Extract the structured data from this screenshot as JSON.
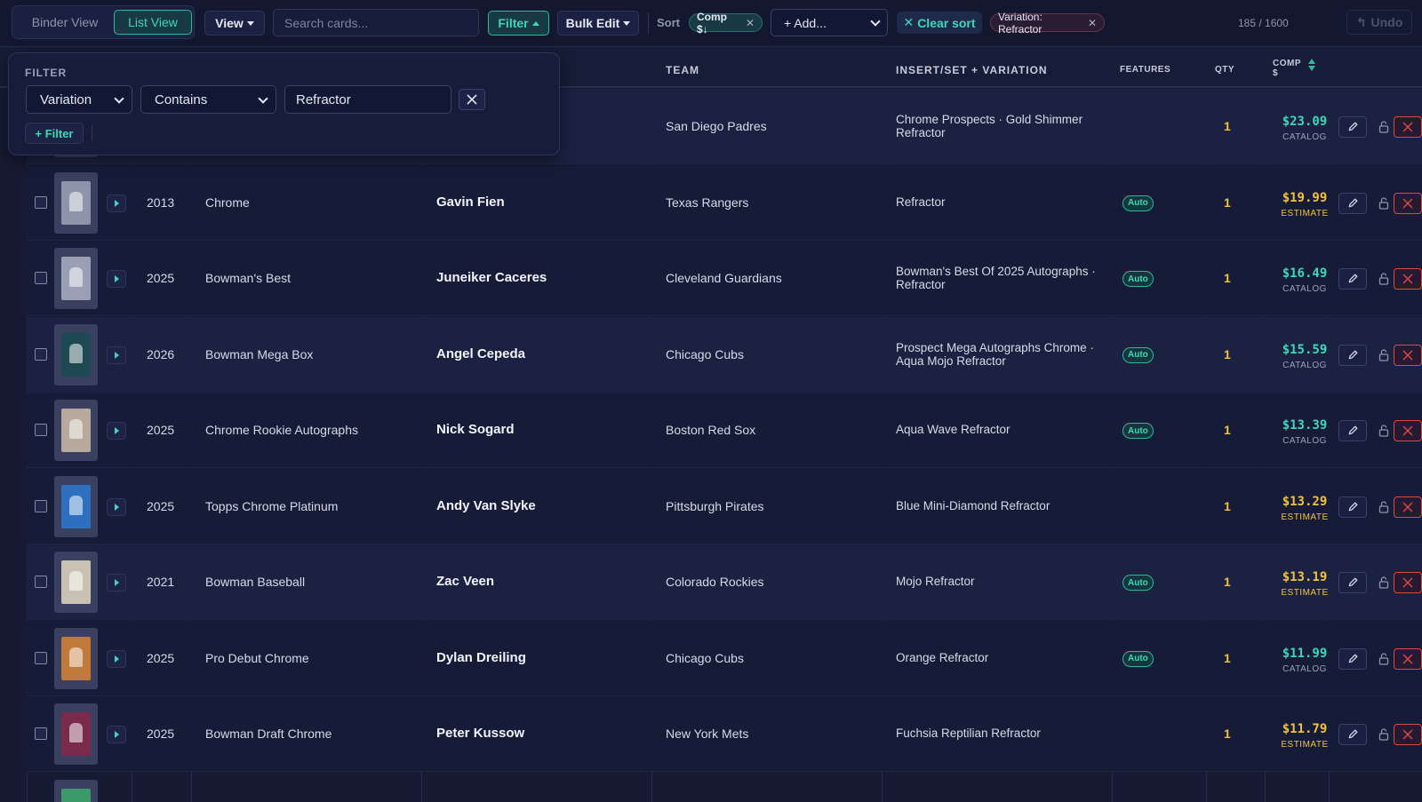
{
  "toolbar": {
    "binder_view": "Binder View",
    "list_view": "List View",
    "view": "View",
    "search_placeholder": "Search cards...",
    "filter": "Filter",
    "bulk_edit": "Bulk Edit",
    "sort_label": "Sort",
    "sort_chip": "Comp $↓",
    "add": "+ Add...",
    "clear_sort": "Clear sort",
    "variation_chip": "Variation: Refractor",
    "count": "185 / 1600",
    "undo": "Undo"
  },
  "table": {
    "headers": {
      "team": "TEAM",
      "insert": "INSERT/SET + VARIATION",
      "features": "FEATURES",
      "qty": "QTY",
      "comp_line1": "COMP",
      "comp_line2": "$"
    },
    "rows": [
      {
        "year": "",
        "set": "",
        "player": "",
        "team": "San Diego Padres",
        "insert_line1": "Chrome Prospects · Gold Shimmer",
        "insert_line2": "Refractor",
        "feature": "",
        "qty": "1",
        "price": "$23.09",
        "source": "CATALOG"
      },
      {
        "year": "2013",
        "set": "Chrome",
        "player": "Gavin Fien",
        "team": "Texas Rangers",
        "insert_line1": "Refractor",
        "insert_line2": "",
        "feature": "Auto",
        "qty": "1",
        "price": "$19.99",
        "source": "ESTIMATE"
      },
      {
        "year": "2025",
        "set": "Bowman's Best",
        "player": "Juneiker Caceres",
        "team": "Cleveland Guardians",
        "insert_line1": "Bowman's Best Of 2025 Autographs ·",
        "insert_line2": "Refractor",
        "feature": "Auto",
        "qty": "1",
        "price": "$16.49",
        "source": "CATALOG"
      },
      {
        "year": "2026",
        "set": "Bowman Mega Box",
        "player": "Angel Cepeda",
        "team": "Chicago Cubs",
        "insert_line1": "Prospect Mega Autographs Chrome ·",
        "insert_line2": "Aqua Mojo Refractor",
        "feature": "Auto",
        "qty": "1",
        "price": "$15.59",
        "source": "CATALOG"
      },
      {
        "year": "2025",
        "set": "Chrome Rookie Autographs",
        "player": "Nick Sogard",
        "team": "Boston Red Sox",
        "insert_line1": "Aqua Wave Refractor",
        "insert_line2": "",
        "feature": "Auto",
        "qty": "1",
        "price": "$13.39",
        "source": "CATALOG"
      },
      {
        "year": "2025",
        "set": "Topps Chrome Platinum",
        "player": "Andy Van Slyke",
        "team": "Pittsburgh Pirates",
        "insert_line1": "Blue Mini-Diamond Refractor",
        "insert_line2": "",
        "feature": "",
        "qty": "1",
        "price": "$13.29",
        "source": "ESTIMATE"
      },
      {
        "year": "2021",
        "set": "Bowman Baseball",
        "player": "Zac Veen",
        "team": "Colorado Rockies",
        "insert_line1": "Mojo Refractor",
        "insert_line2": "",
        "feature": "Auto",
        "qty": "1",
        "price": "$13.19",
        "source": "ESTIMATE"
      },
      {
        "year": "2025",
        "set": "Pro Debut Chrome",
        "player": "Dylan Dreiling",
        "team": "Chicago Cubs",
        "insert_line1": "Orange Refractor",
        "insert_line2": "",
        "feature": "Auto",
        "qty": "1",
        "price": "$11.99",
        "source": "CATALOG"
      },
      {
        "year": "2025",
        "set": "Bowman Draft Chrome",
        "player": "Peter Kussow",
        "team": "New York Mets",
        "insert_line1": "Fuchsia Reptilian Refractor",
        "insert_line2": "",
        "feature": "",
        "qty": "1",
        "price": "$11.79",
        "source": "ESTIMATE"
      }
    ]
  },
  "filter_panel": {
    "title": "FILTER",
    "field": "Variation",
    "operator": "Contains",
    "value": "Refractor",
    "add_filter": "+ Filter"
  },
  "colors": {
    "accent": "#3fd7b8",
    "estimate": "#f3c23d",
    "danger": "#e0453f",
    "thumb_colors": [
      "#8d93a8",
      "#8e94aa",
      "#9a9fb5",
      "#1d4a52",
      "#b7a99d",
      "#2f6fc0",
      "#c9c2b4",
      "#c07a3a",
      "#7a2a4a",
      "#3a9a6a"
    ]
  }
}
